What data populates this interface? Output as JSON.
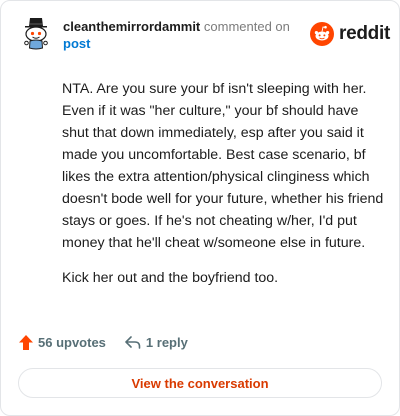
{
  "comment": {
    "username": "cleanthemirrordammit",
    "action_text": "commented on",
    "post_link": "post",
    "paragraphs": [
      "NTA. Are you sure your bf isn't sleeping with her. Even if it was \"her culture,\" your bf should have shut that down immediately, esp after you said it made you uncomfortable. Best case scenario, bf likes the extra attention/physical clinginess which doesn't bode well for your future, whether his friend stays or goes. If he's not cheating w/her, I'd put money that he'll cheat w/someone else in future.",
      "Kick her out and the boyfriend too."
    ],
    "upvotes": "56 upvotes",
    "replies": "1 reply"
  },
  "brand": {
    "name": "reddit",
    "accent": "#ff4500",
    "icon": "reddit-logo-icon"
  },
  "footer": {
    "view_button": "View the conversation"
  },
  "colors": {
    "upvote": "#ff4500",
    "link": "#0079d3",
    "button_text": "#d93a00"
  }
}
